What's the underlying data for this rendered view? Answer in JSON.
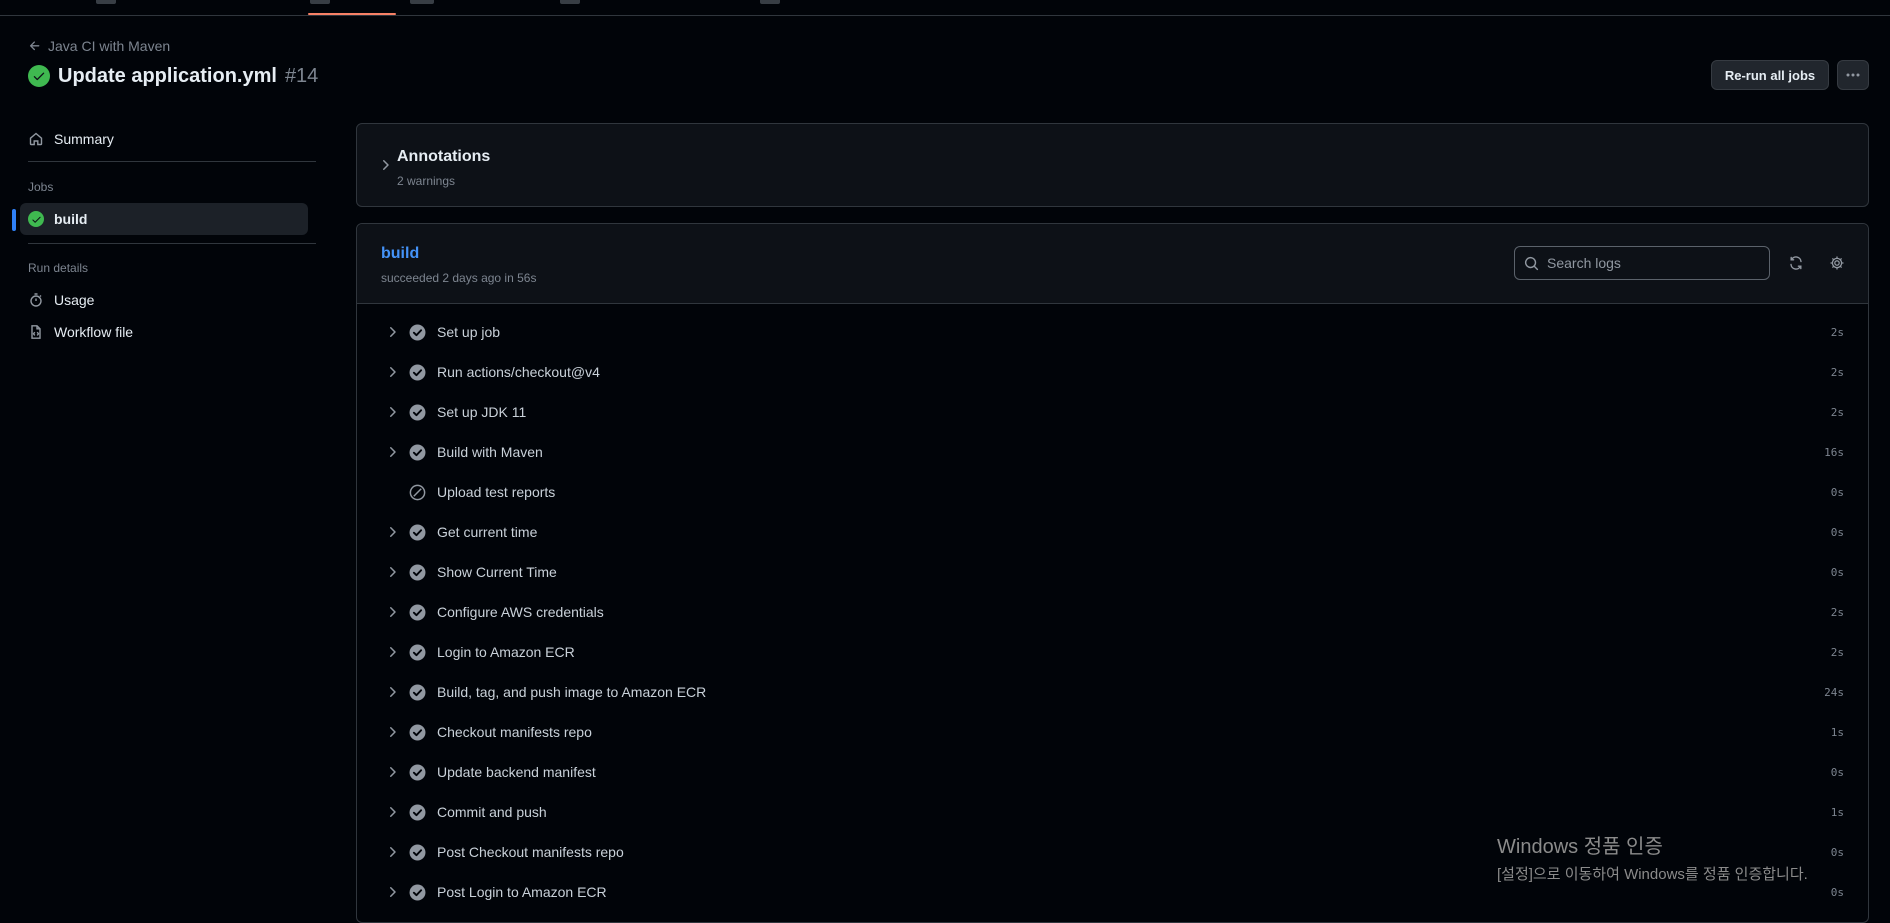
{
  "breadcrumb": {
    "back_label": "Java CI with Maven"
  },
  "run": {
    "title": "Update application.yml",
    "number": "#14"
  },
  "actions": {
    "rerun_label": "Re-run all jobs"
  },
  "sidebar": {
    "summary_label": "Summary",
    "jobs_heading": "Jobs",
    "jobs": [
      {
        "label": "build"
      }
    ],
    "run_details_heading": "Run details",
    "items": [
      {
        "label": "Usage"
      },
      {
        "label": "Workflow file"
      }
    ]
  },
  "annotations": {
    "title": "Annotations",
    "subtitle": "2 warnings"
  },
  "job": {
    "name": "build",
    "meta": "succeeded 2 days ago in 56s",
    "search_placeholder": "Search logs"
  },
  "steps": [
    {
      "name": "Set up job",
      "duration": "2s",
      "status": "success"
    },
    {
      "name": "Run actions/checkout@v4",
      "duration": "2s",
      "status": "success"
    },
    {
      "name": "Set up JDK 11",
      "duration": "2s",
      "status": "success"
    },
    {
      "name": "Build with Maven",
      "duration": "16s",
      "status": "success"
    },
    {
      "name": "Upload test reports",
      "duration": "0s",
      "status": "skipped"
    },
    {
      "name": "Get current time",
      "duration": "0s",
      "status": "success"
    },
    {
      "name": "Show Current Time",
      "duration": "0s",
      "status": "success"
    },
    {
      "name": "Configure AWS credentials",
      "duration": "2s",
      "status": "success"
    },
    {
      "name": "Login to Amazon ECR",
      "duration": "2s",
      "status": "success"
    },
    {
      "name": "Build, tag, and push image to Amazon ECR",
      "duration": "24s",
      "status": "success"
    },
    {
      "name": "Checkout manifests repo",
      "duration": "1s",
      "status": "success"
    },
    {
      "name": "Update backend manifest",
      "duration": "0s",
      "status": "success"
    },
    {
      "name": "Commit and push",
      "duration": "1s",
      "status": "success"
    },
    {
      "name": "Post Checkout manifests repo",
      "duration": "0s",
      "status": "success"
    },
    {
      "name": "Post Login to Amazon ECR",
      "duration": "0s",
      "status": "success"
    }
  ],
  "watermark": {
    "line1": "Windows 정품 인증",
    "line2": "[설정]으로 이동하여 Windows를 정품 인증합니다."
  },
  "colors": {
    "success": "#3fb950",
    "accent": "#2f81f7",
    "link": "#4493f8",
    "muted": "#7d8590",
    "tab_underline": "#f78166"
  }
}
